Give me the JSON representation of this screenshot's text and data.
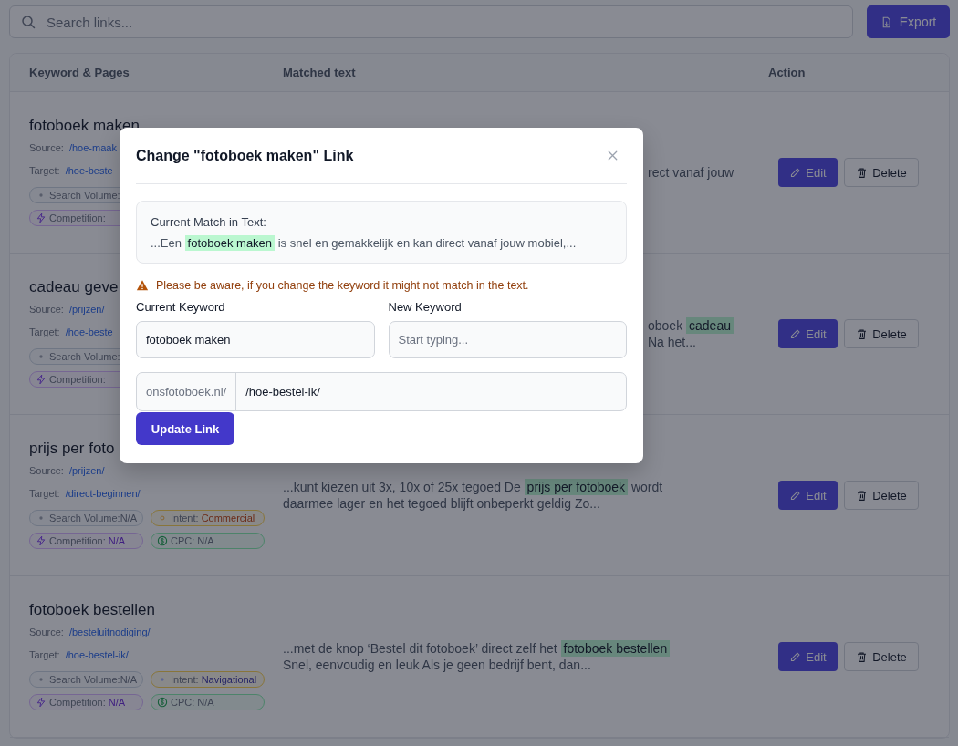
{
  "search": {
    "placeholder": "Search links..."
  },
  "export_button": "Export",
  "table": {
    "columns": [
      "Keyword & Pages",
      "Matched text",
      "Action"
    ],
    "rows": [
      {
        "kind": "covered",
        "keyword": "fotoboek maken",
        "source_label": "Source:",
        "source": "/hoe-maak",
        "target_label": "Target:",
        "target": "/hoe-beste",
        "badges": [
          {
            "kind": "volume",
            "label": "Search Volume:"
          },
          {
            "kind": "competition",
            "label": "Competition:"
          }
        ],
        "matched_lines": [
          [
            {
              "text": "rect vanaf jouw"
            }
          ]
        ],
        "edit": "Edit",
        "delete": "Delete"
      },
      {
        "kind": "covered",
        "keyword": "cadeau geve",
        "source_label": "Source:",
        "source": "/prijzen/",
        "target_label": "Target:",
        "target": "/hoe-beste",
        "badges": [
          {
            "kind": "volume",
            "label": "Search Volume:"
          },
          {
            "kind": "competition",
            "label": "Competition:"
          }
        ],
        "matched_lines": [
          [
            {
              "text": "oboek "
            },
            {
              "text": "cadeau",
              "highlight": true
            }
          ],
          [
            {
              "text": "Na het..."
            }
          ]
        ],
        "edit": "Edit",
        "delete": "Delete"
      },
      {
        "kind": "full",
        "keyword": "prijs per foto",
        "source_label": "Source:",
        "source": "/prijzen/",
        "target_label": "Target:",
        "target": "/direct-beginnen/",
        "badges": [
          {
            "kind": "volume",
            "label": "Search Volume:",
            "value": "N/A"
          },
          {
            "kind": "intent",
            "label": "Intent:",
            "value": "Commercial"
          },
          {
            "kind": "competition",
            "label": "Competition:",
            "value": "N/A"
          },
          {
            "kind": "cpc",
            "label": "CPC:",
            "value": "N/A"
          }
        ],
        "matched_lines": [
          [
            {
              "text": "...kunt kiezen uit 3x, 10x of 25x tegoed De "
            },
            {
              "text": "prijs per fotoboek",
              "highlight": true
            },
            {
              "text": " wordt"
            }
          ],
          [
            {
              "text": "daarmee lager en het tegoed blijft onbeperkt geldig Zo..."
            }
          ]
        ],
        "edit": "Edit",
        "delete": "Delete"
      },
      {
        "kind": "full",
        "keyword": "fotoboek bestellen",
        "source_label": "Source:",
        "source": "/besteluitnodiging/",
        "target_label": "Target:",
        "target": "/hoe-bestel-ik/",
        "badges": [
          {
            "kind": "volume",
            "label": "Search Volume:",
            "value": "N/A"
          },
          {
            "kind": "intent",
            "label": "Intent:",
            "value": "Navigational"
          },
          {
            "kind": "competition",
            "label": "Competition:",
            "value": "N/A"
          },
          {
            "kind": "cpc",
            "label": "CPC:",
            "value": "N/A"
          }
        ],
        "matched_lines": [
          [
            {
              "text": "...met de knop ‘Bestel dit fotoboek’ direct zelf het "
            },
            {
              "text": "fotoboek bestellen",
              "highlight": true
            }
          ],
          [
            {
              "text": "Snel, eenvoudig en leuk Als je geen bedrijf bent, dan..."
            }
          ]
        ],
        "edit": "Edit",
        "delete": "Delete"
      }
    ]
  },
  "modal": {
    "title": "Change \"fotoboek maken\" Link",
    "match_label": "Current Match in Text:",
    "match_text": [
      {
        "text": "...Een "
      },
      {
        "text": "fotoboek maken",
        "highlight": true
      },
      {
        "text": " is snel en gemakkelijk en kan direct vanaf jouw mobiel,..."
      }
    ],
    "warning": "Please be aware, if you change the keyword it might not match in the text.",
    "current_keyword": {
      "label": "Current Keyword",
      "value": "fotoboek maken"
    },
    "new_keyword": {
      "label": "New Keyword",
      "placeholder": "Start typing..."
    },
    "url": {
      "prefix": "onsfotoboek.nl/",
      "value": "/hoe-bestel-ik/"
    },
    "submit": "Update Link"
  }
}
